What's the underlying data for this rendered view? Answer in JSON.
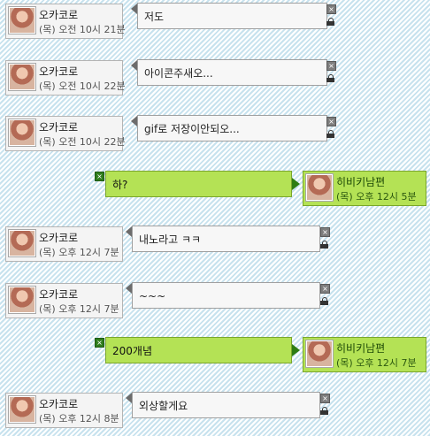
{
  "colors": {
    "background_stripe": "#c7e2ee",
    "other_bubble": "#f7f7f7",
    "mine_bubble": "#b4e255",
    "mine_arrow": "#2e7d12"
  },
  "icons": {
    "close": "×",
    "lock": "lock-icon"
  },
  "messages": [
    {
      "side": "other",
      "name": "오카코로",
      "time": "(목) 오전 10시 21분",
      "text": "저도"
    },
    {
      "side": "other",
      "name": "오카코로",
      "time": "(목) 오전 10시 22분",
      "text": "아이콘주새오..."
    },
    {
      "side": "other",
      "name": "오카코로",
      "time": "(목) 오전 10시 22분",
      "text": "gif로 저장이안되오..."
    },
    {
      "side": "mine",
      "name": "히비키남편",
      "time": "(목) 오후 12시 5분",
      "text": "하?"
    },
    {
      "side": "other",
      "name": "오카코로",
      "time": "(목) 오후 12시 7분",
      "text": "내노라고 ㅋㅋ"
    },
    {
      "side": "other",
      "name": "오카코로",
      "time": "(목) 오후 12시 7분",
      "text": "~~~"
    },
    {
      "side": "mine",
      "name": "히비키남편",
      "time": "(목) 오후 12시 7분",
      "text": "200개념"
    },
    {
      "side": "other",
      "name": "오카코로",
      "time": "(목) 오후 12시 8분",
      "text": "외상할게요"
    }
  ]
}
